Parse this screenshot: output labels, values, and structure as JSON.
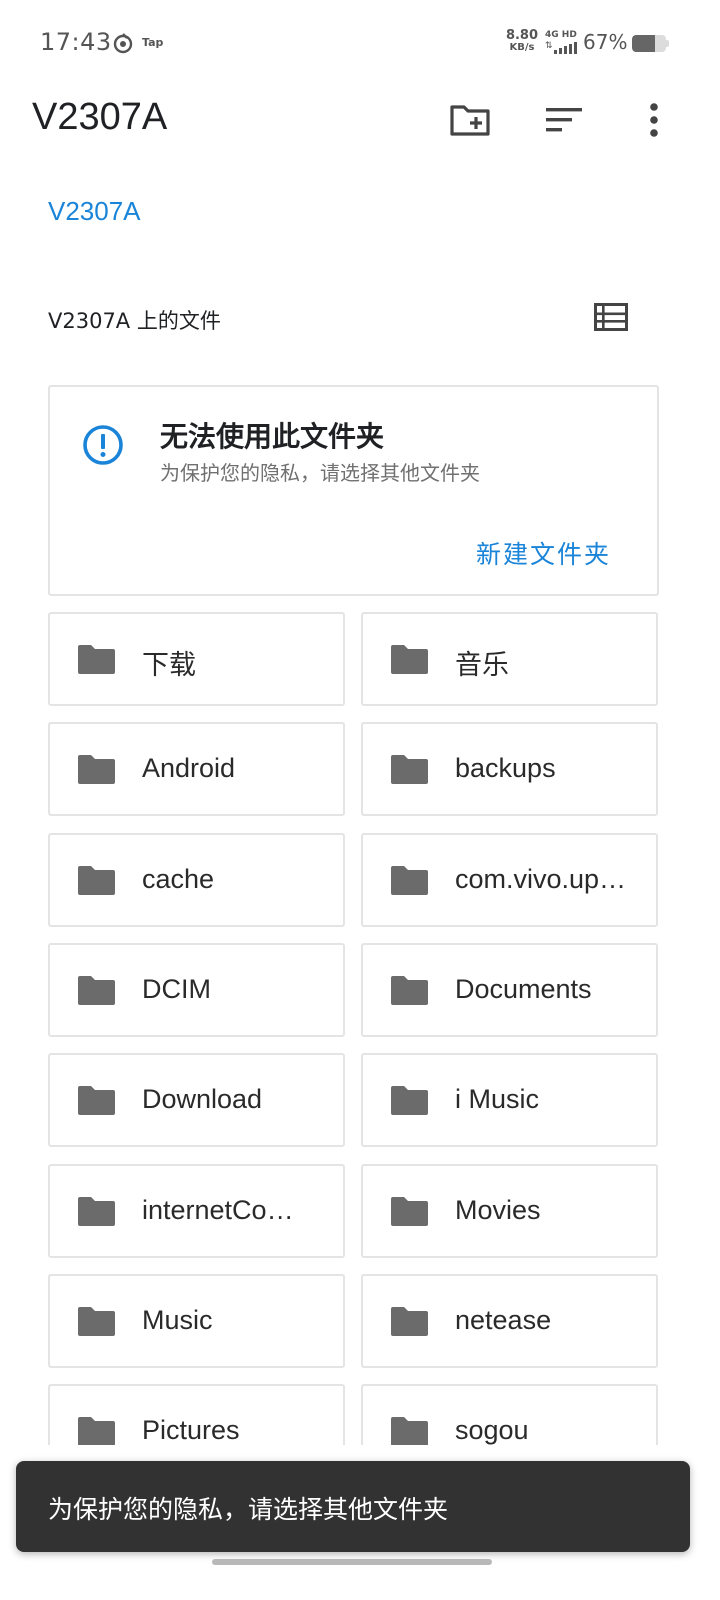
{
  "status_bar": {
    "time": "17:43",
    "app_badge": "Tap",
    "net_speed_value": "8.80",
    "net_speed_unit": "KB/s",
    "network_type": "4G HD",
    "battery_percent": "67%",
    "battery_level": 0.67
  },
  "app_bar": {
    "title": "V2307A",
    "icons": [
      "create-new-folder-icon",
      "sort-icon",
      "more-vert-icon"
    ]
  },
  "breadcrumb": "V2307A",
  "section": {
    "title": "V2307A 上的文件",
    "view_toggle_icon": "list-view-icon"
  },
  "warning": {
    "icon": "info-icon",
    "title": "无法使用此文件夹",
    "description": "为保护您的隐私，请选择其他文件夹",
    "action": "新建文件夹",
    "accent_color": "#1a84d8"
  },
  "folders": [
    {
      "name": "下载"
    },
    {
      "name": "音乐"
    },
    {
      "name": "Android"
    },
    {
      "name": "backups"
    },
    {
      "name": "cache"
    },
    {
      "name": "com.vivo.up…"
    },
    {
      "name": "DCIM"
    },
    {
      "name": "Documents"
    },
    {
      "name": "Download"
    },
    {
      "name": "i Music"
    },
    {
      "name": "internetCo…"
    },
    {
      "name": "Movies"
    },
    {
      "name": "Music"
    },
    {
      "name": "netease"
    },
    {
      "name": "Pictures"
    },
    {
      "name": "sogou"
    }
  ],
  "snackbar": {
    "text": "为保护您的隐私，请选择其他文件夹"
  }
}
